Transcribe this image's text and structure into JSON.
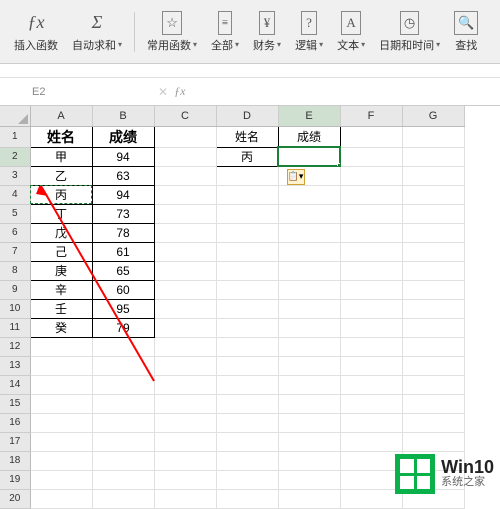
{
  "toolbar": {
    "insert_fn": "插入函数",
    "autosum": "自动求和",
    "common": "常用函数",
    "all": "全部",
    "finance": "财务",
    "logic": "逻辑",
    "text": "文本",
    "datetime": "日期和时间",
    "lookup": "查找"
  },
  "namebox": {
    "value": "E2"
  },
  "formula": {
    "value": ""
  },
  "columns": [
    "A",
    "B",
    "C",
    "D",
    "E",
    "F",
    "G"
  ],
  "rows": [
    "1",
    "2",
    "3",
    "4",
    "5",
    "6",
    "7",
    "8",
    "9",
    "10",
    "11",
    "12",
    "13",
    "14",
    "15",
    "16",
    "17",
    "18",
    "19",
    "20"
  ],
  "tableA": {
    "header_name": "姓名",
    "header_score": "成绩",
    "rows": [
      {
        "name": "甲",
        "score": "94"
      },
      {
        "name": "乙",
        "score": "63"
      },
      {
        "name": "丙",
        "score": "94"
      },
      {
        "name": "丁",
        "score": "73"
      },
      {
        "name": "戊",
        "score": "78"
      },
      {
        "name": "己",
        "score": "61"
      },
      {
        "name": "庚",
        "score": "65"
      },
      {
        "name": "辛",
        "score": "60"
      },
      {
        "name": "壬",
        "score": "95"
      },
      {
        "name": "癸",
        "score": "79"
      }
    ]
  },
  "tableB": {
    "header_name": "姓名",
    "header_score": "成绩",
    "name_val": "丙",
    "score_val": ""
  },
  "watermark": {
    "title": "Win10",
    "subtitle": "系统之家"
  },
  "fx_label": "fx",
  "sigma": "Σ"
}
